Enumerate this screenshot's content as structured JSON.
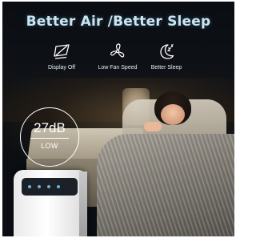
{
  "headline": "Better Air /Better Sleep",
  "features": [
    {
      "icon": "display-off-icon",
      "label": "Display Off"
    },
    {
      "icon": "fan-icon",
      "label": "Low Fan Speed"
    },
    {
      "icon": "moon-sleep-icon",
      "label": "Better Sleep"
    }
  ],
  "noise_badge": {
    "value": "27dB",
    "level": "LOW"
  },
  "colors": {
    "headline": "#c9e6f4",
    "icon_stroke": "#ffffff",
    "background": "#0b0e12"
  }
}
